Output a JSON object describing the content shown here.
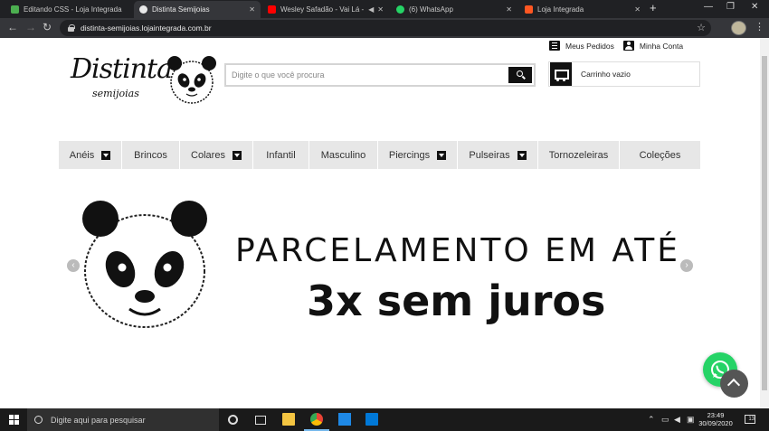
{
  "browser": {
    "tabs": [
      {
        "title": "Editando CSS - Loja Integrada",
        "favicon_color": "#4caf50"
      },
      {
        "title": "Distinta Semijoias",
        "favicon_color": "#e8e8e8"
      },
      {
        "title": "Wesley Safadão - Vai Lá -",
        "favicon_color": "#ff0000"
      },
      {
        "title": "(6) WhatsApp",
        "favicon_color": "#25d366"
      },
      {
        "title": "Loja Integrada",
        "favicon_color": "#ff5722"
      }
    ],
    "url": "distinta-semijoias.lojaintegrada.com.br"
  },
  "site": {
    "top_links": {
      "orders": "Meus Pedidos",
      "account": "Minha Conta"
    },
    "logo": {
      "name": "Distinta",
      "sub": "semijoias"
    },
    "search": {
      "placeholder": "Digite o que você procura"
    },
    "cart": {
      "label": "Carrinho vazio"
    },
    "menu": [
      {
        "label": "Anéis",
        "dropdown": true
      },
      {
        "label": "Brincos",
        "dropdown": false
      },
      {
        "label": "Colares",
        "dropdown": true
      },
      {
        "label": "Infantil",
        "dropdown": false
      },
      {
        "label": "Masculino",
        "dropdown": false
      },
      {
        "label": "Piercings",
        "dropdown": true
      },
      {
        "label": "Pulseiras",
        "dropdown": true
      },
      {
        "label": "Tornozeleiras",
        "dropdown": false
      },
      {
        "label": "Coleções",
        "dropdown": false
      }
    ],
    "banner": {
      "line1": "PARCELAMENTO EM ATÉ",
      "line2": "3x sem juros"
    }
  },
  "taskbar": {
    "search_placeholder": "Digite aqui para pesquisar",
    "time": "23:49",
    "date": "30/09/2020",
    "notifications": "13"
  }
}
